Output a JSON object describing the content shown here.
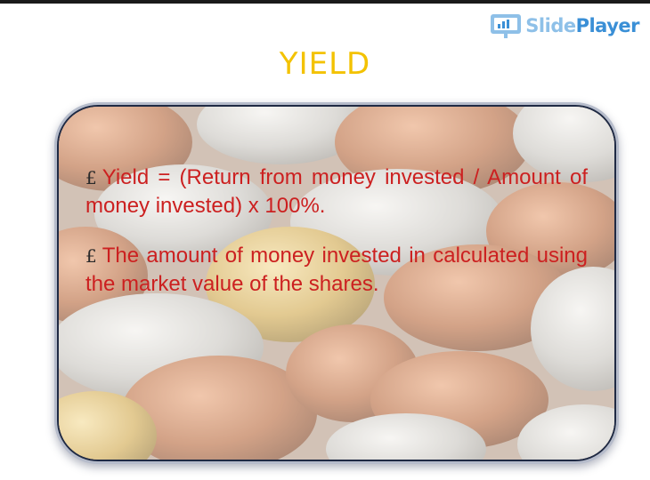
{
  "slide": {
    "title": "YIELD",
    "bullet_symbol": "£",
    "paragraphs": [
      "Yield = (Return from money invested / Amount of money invested) x 100%.",
      "The amount of money invested in calculated using the market value of the shares."
    ]
  },
  "brand": {
    "logo_part1": "Slide",
    "logo_part2": "Player"
  },
  "colors": {
    "title": "#f3c200",
    "body_text": "#cc2020",
    "logo_light": "#8ec0e8",
    "logo_dark": "#3a8fd6"
  }
}
